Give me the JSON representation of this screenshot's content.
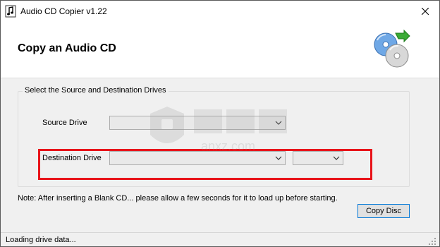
{
  "window": {
    "title": "Audio CD Copier v1.22"
  },
  "header": {
    "title": "Copy an Audio CD",
    "logo_icon": "cd-copy-icon"
  },
  "drives_group": {
    "legend": "Select the Source and Destination Drives",
    "source_label": "Source Drive",
    "source_value": "",
    "destination_label": "Destination Drive",
    "destination_value": "",
    "speed_value": ""
  },
  "note": "Note: After inserting a Blank CD... please allow a few seconds for it to load up before starting.",
  "buttons": {
    "copy_label": "Copy Disc"
  },
  "status": {
    "text": "Loading drive data..."
  },
  "watermark": {
    "text": "anxz.com"
  },
  "colors": {
    "highlight": "#e8141a",
    "focus_border": "#0078d7",
    "window_bg": "#f0f0f0"
  }
}
